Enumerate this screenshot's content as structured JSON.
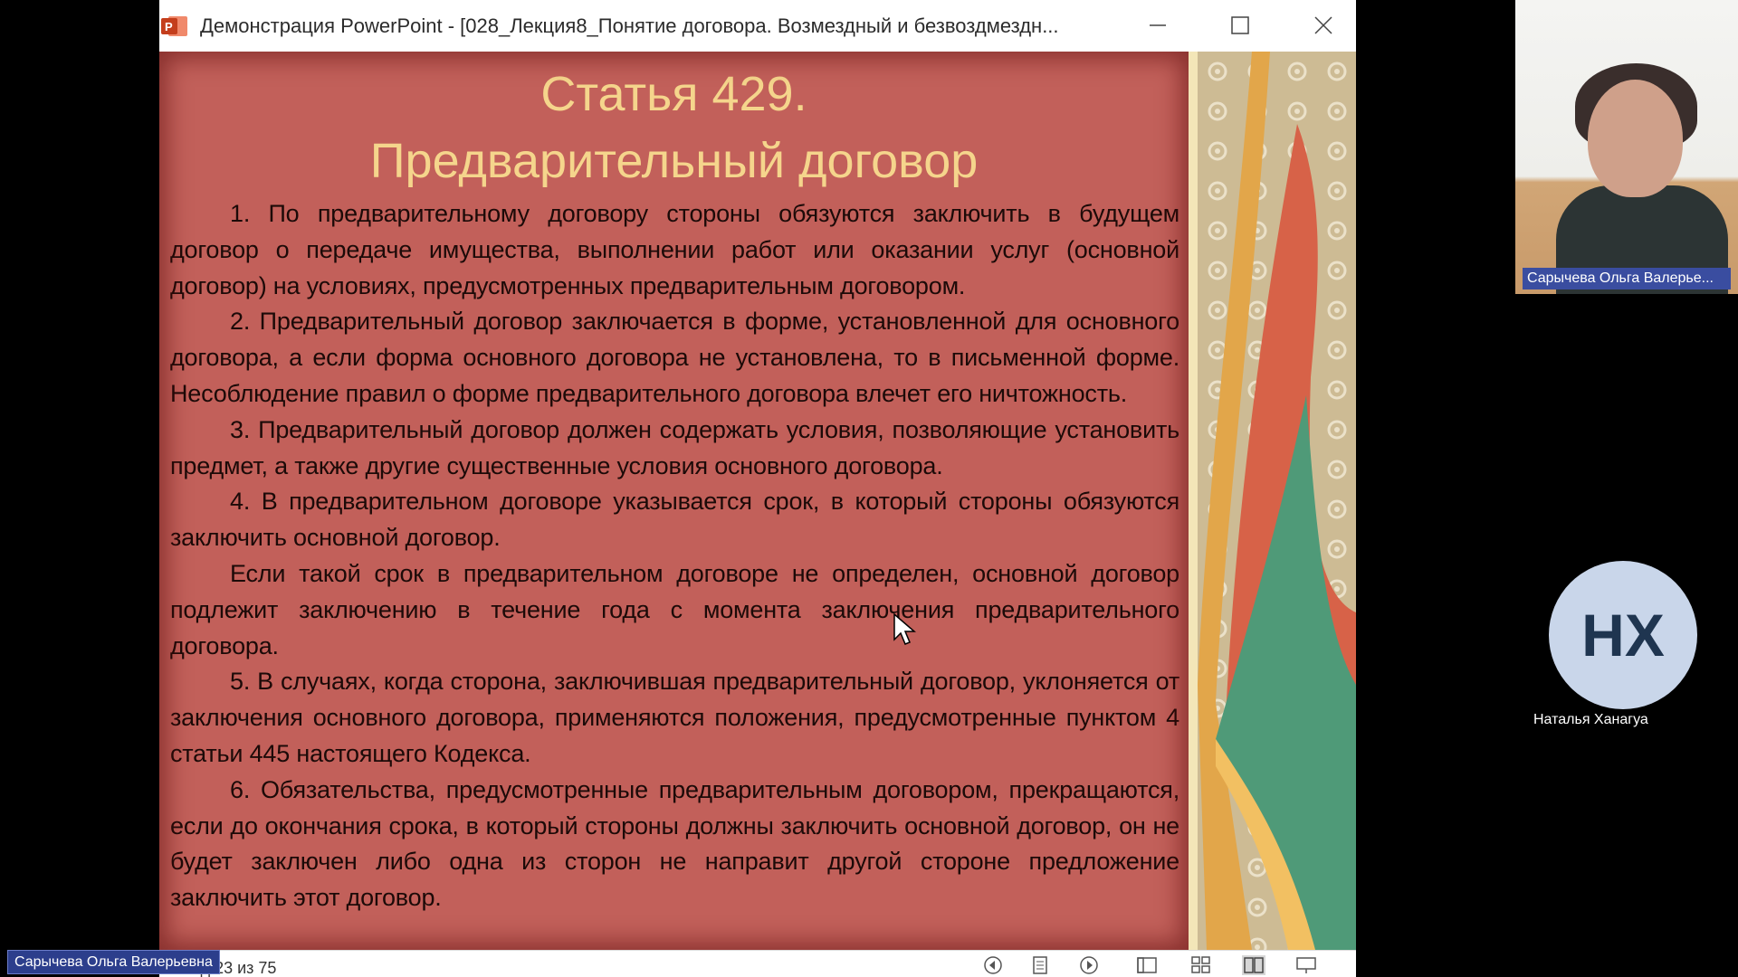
{
  "window": {
    "title": "Демонстрация PowerPoint - [028_Лекция8_Понятие договора. Возмездный и безвоздмездн..."
  },
  "slide": {
    "heading_line1": "Статья 429.",
    "heading_line2": "Предварительный договор",
    "paragraphs": [
      "1. По предварительному договору стороны обязуются заключить в будущем договор о передаче имущества, выполнении работ или оказании услуг (основной договор) на условиях, предусмотренных предварительным договором.",
      "2. Предварительный договор заключается в форме, установленной для основного договора, а если форма основного договора не установлена, то в письменной форме. Несоблюдение правил о форме предварительного договора влечет его ничтожность.",
      "3. Предварительный договор должен содержать условия, позволяющие установить предмет, а также другие существенные условия основного договора.",
      "4. В предварительном договоре указывается срок, в который стороны обязуются заключить основной договор.",
      "Если такой срок в предварительном договоре не определен, основной договор подлежит заключению в течение года с момента заключения предварительного договора.",
      "5. В случаях, когда сторона, заключившая предварительный договор, уклоняется от заключения основного договора, применяются положения, предусмотренные пунктом 4 статьи 445 настоящего Кодекса.",
      "6. Обязательства, предусмотренные предварительным договором, прекращаются, если до окончания срока, в который стороны должны заключить основной договор, он не будет заключен либо одна из сторон не направит другой стороне предложение заключить этот договор."
    ]
  },
  "status_bar": {
    "slide_counter": "Слайд 23 из 75"
  },
  "participants": {
    "presenter_tag": "Сарычева Ольга Валерьевна",
    "video_name": "Сарычева Ольга Валерье...",
    "avatar_initials": "НХ",
    "avatar_name": "Наталья Ханагуа"
  },
  "colors": {
    "slide_bg": "#c2605a",
    "heading": "#f5d58c",
    "name_tag": "#2c3e8c"
  }
}
